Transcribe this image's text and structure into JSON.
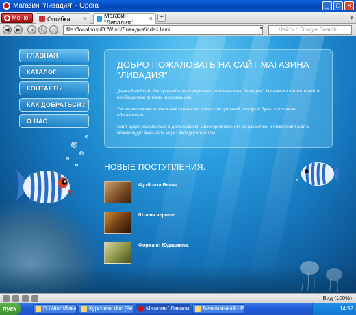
{
  "window": {
    "title": "Магазин \"Ливадия\" - Opera"
  },
  "tabs": {
    "menu_label": "Меню",
    "items": [
      {
        "label": "Ошибка"
      },
      {
        "label": "Магазин \"Ливадия\""
      }
    ]
  },
  "address": {
    "url": "file://localhost/D:/Wind/Ливадия/index.html",
    "search_placeholder": "Найти с Google Search"
  },
  "site": {
    "menu": [
      "ГЛАВНАЯ",
      "КАТАЛОГ",
      "КОНТАКТЫ",
      "КАК ДОБРАТЬСЯ?",
      "О НАС"
    ],
    "welcome": {
      "heading": "ДОБРО ПОЖАЛОВАТЬ НА САЙТ МАГАЗИНА \"ЛИВАДИЯ\"",
      "p1": "Данный веб сайт был разработан специально для магазина \"Ливадия\". На нем вы сможете найти необходимую для вас информацию.",
      "p2": "Так же вы сможете здесь найти каталог новых поступлений, который будет постоянно обновляться.",
      "p3": "Сайт будет развиваться в дальнейшем. Свои предложения по развитию, и пожелания сайта можно будет высылать через вкладку контакты."
    },
    "arrivals_title": "НОВЫЕ ПОСТУПЛЕНИЯ.",
    "arrivals": [
      {
        "name": "Футболка Белая",
        "thumb_color": "#9a6a3a"
      },
      {
        "name": "Штаны черные",
        "thumb_color": "#6b3a12"
      },
      {
        "name": "Форма от Юдашкина.",
        "thumb_color": "#8f9a4a"
      }
    ]
  },
  "statusbar": {
    "zoom": "Вид (100%)"
  },
  "taskbar": {
    "start_label": "пуск",
    "tasks": [
      "D:\\Wind\\Ливадия",
      "Курсовая.doc [Режим с...",
      "Магазин \"Ливадия\" - ...",
      "Безымянный - Paint"
    ],
    "clock": "14:52"
  },
  "colors": {
    "accent": "#2a9ee0",
    "deep": "#0b4e88",
    "opera_red": "#d01010"
  }
}
